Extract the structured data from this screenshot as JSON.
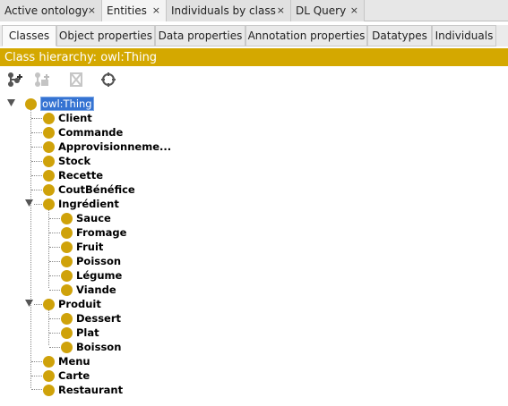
{
  "top_tabs": [
    {
      "label": "Active ontology",
      "close": "×",
      "active": false
    },
    {
      "label": "Entities",
      "close": "×",
      "active": true
    },
    {
      "label": "Individuals by class",
      "close": "×",
      "active": false
    },
    {
      "label": "DL Query",
      "close": "×",
      "active": false
    }
  ],
  "sub_tabs": [
    {
      "label": "Classes",
      "active": true
    },
    {
      "label": "Object properties",
      "active": false
    },
    {
      "label": "Data properties",
      "active": false
    },
    {
      "label": "Annotation properties",
      "active": false
    },
    {
      "label": "Datatypes",
      "active": false
    },
    {
      "label": "Individuals",
      "active": false
    }
  ],
  "hierarchy": {
    "title": "Class hierarchy: owl:Thing"
  },
  "toolbar": {
    "icons": [
      "add-subclass-icon",
      "add-sibling-icon",
      "delete-class-icon",
      "find-icon"
    ]
  },
  "tree": {
    "root": "owl:Thing",
    "nodes": [
      {
        "label": "Client"
      },
      {
        "label": "Commande"
      },
      {
        "label": "Approvisionneme..."
      },
      {
        "label": "Stock"
      },
      {
        "label": "Recette"
      },
      {
        "label": "CoutBénéfice"
      },
      {
        "label": "Ingrédient"
      },
      {
        "label": "Sauce"
      },
      {
        "label": "Fromage"
      },
      {
        "label": "Fruit"
      },
      {
        "label": "Poisson"
      },
      {
        "label": "Légume"
      },
      {
        "label": "Viande"
      },
      {
        "label": "Produit"
      },
      {
        "label": "Dessert"
      },
      {
        "label": "Plat"
      },
      {
        "label": "Boisson"
      },
      {
        "label": "Menu"
      },
      {
        "label": "Carte"
      },
      {
        "label": "Restaurant"
      }
    ]
  },
  "colors": {
    "accent": "#d4a800",
    "class_dot": "#cfa20a",
    "selection": "#3573d2"
  }
}
